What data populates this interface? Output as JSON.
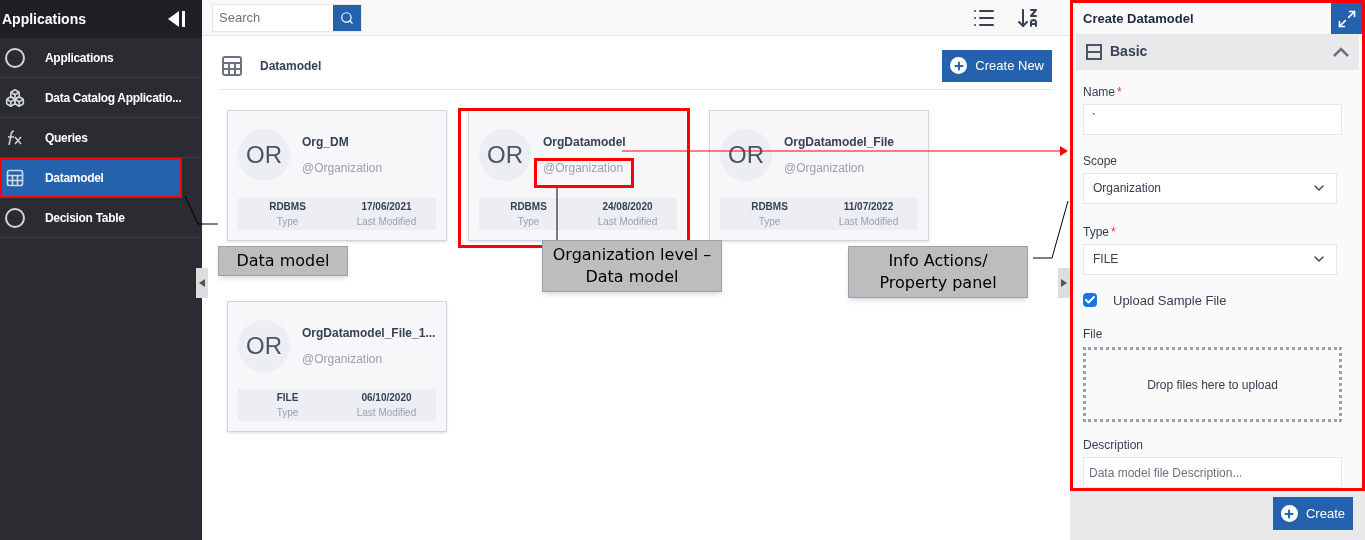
{
  "sidebar": {
    "title": "Applications",
    "items": [
      {
        "label": "Applications",
        "selected": false
      },
      {
        "label": "Data Catalog Applicatio...",
        "selected": false
      },
      {
        "label": "Queries",
        "selected": false
      },
      {
        "label": "Datamodel",
        "selected": true
      },
      {
        "label": "Decision Table",
        "selected": false
      }
    ]
  },
  "search": {
    "placeholder": "Search"
  },
  "section": {
    "title": "Datamodel",
    "create_button": "Create New"
  },
  "cards": [
    {
      "initials": "OR",
      "name": "Org_DM",
      "scope": "@Organization",
      "type": "RDBMS",
      "type_label": "Type",
      "date": "17/06/2021",
      "date_label": "Last Modified"
    },
    {
      "initials": "OR",
      "name": "OrgDatamodel",
      "scope": "@Organization",
      "type": "RDBMS",
      "type_label": "Type",
      "date": "24/08/2020",
      "date_label": "Last Modified"
    },
    {
      "initials": "OR",
      "name": "OrgDatamodel_File",
      "scope": "@Organization",
      "type": "RDBMS",
      "type_label": "Type",
      "date": "11/07/2022",
      "date_label": "Last Modified"
    },
    {
      "initials": "OR",
      "name": "OrgDatamodel_File_1...",
      "scope": "@Organization",
      "type": "FILE",
      "type_label": "Type",
      "date": "06/10/2020",
      "date_label": "Last Modified"
    }
  ],
  "panel": {
    "title": "Create Datamodel",
    "section": "Basic",
    "expanded": true,
    "name_label": "Name",
    "name_required": "*",
    "type_required": "*",
    "name_value": "`",
    "scope_label": "Scope",
    "scope_value": "Organization",
    "type_label": "Type",
    "type_value": "FILE",
    "upload_label": "Upload Sample File",
    "upload_checked": true,
    "file_label": "File",
    "drop_text": "Drop files here to upload",
    "description_label": "Description",
    "description_placeholder": "Data model file Description...",
    "create_button": "Create"
  },
  "callouts": [
    {
      "text": "Data model"
    },
    {
      "text": "Organization level – Data model"
    },
    {
      "text": "Info Actions/ Property panel"
    }
  ]
}
